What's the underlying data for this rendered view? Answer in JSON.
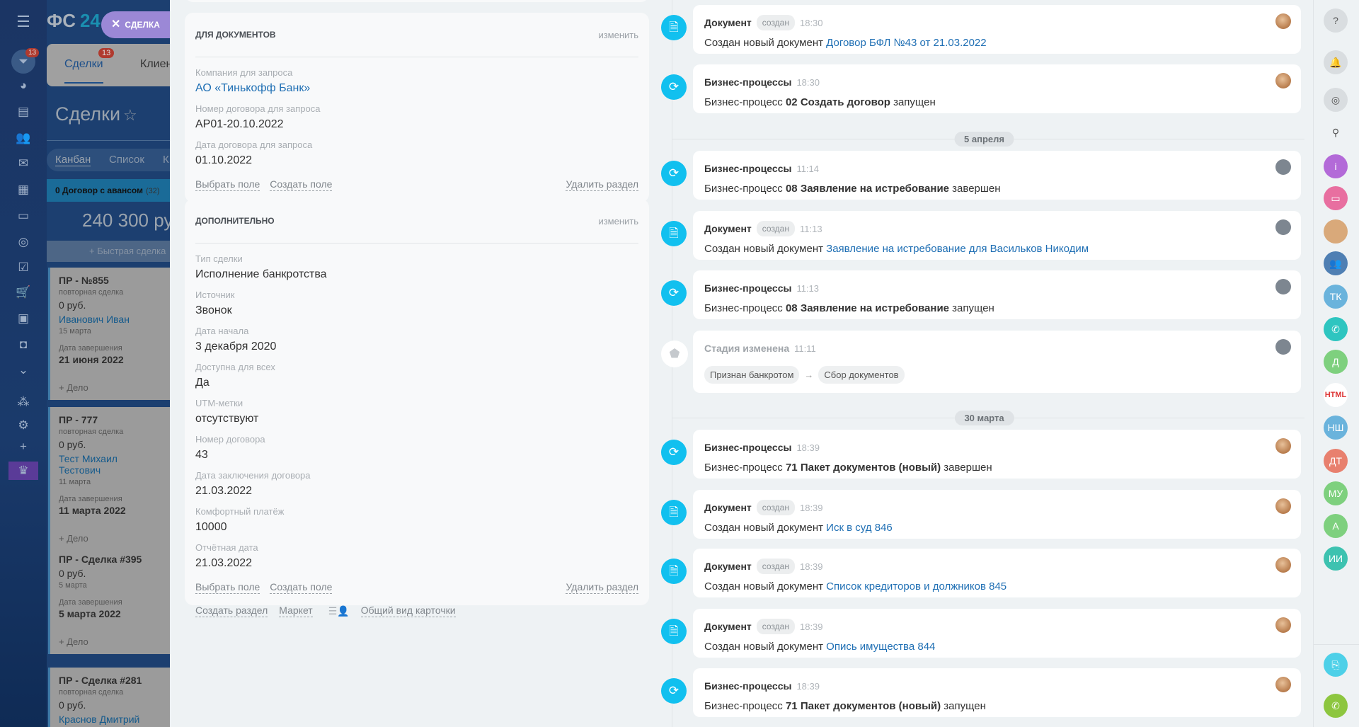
{
  "leftnav": {
    "menu_icon": "hamburger-icon",
    "logo_text": "ФС",
    "logo_num": "24",
    "filter_badge": "13",
    "icons": [
      "funnel-icon",
      "chart-icon",
      "calendar-icon",
      "users-icon",
      "mail-icon",
      "document-icon",
      "contact-card-icon",
      "target-icon",
      "task-icon",
      "cart-icon",
      "box-icon",
      "robot-icon",
      "chevron-down-icon",
      "sitemap-icon",
      "gear-icon",
      "plus-icon",
      "crown-icon"
    ]
  },
  "close_tab": {
    "label": "СДЕЛКА"
  },
  "crm": {
    "tabs": [
      {
        "label": "Сделки",
        "badge": "13"
      },
      {
        "label": "Клиен"
      }
    ],
    "title": "Сделки",
    "views": [
      "Канбан",
      "Список",
      "К"
    ],
    "column": {
      "name": "0 Договор с авансом",
      "count": "(32)",
      "sum": "240 300 ру",
      "quick_add": "Быстрая сделка"
    },
    "cards": [
      {
        "title": "ПР - №855",
        "sub": "повторная сделка",
        "price": "0 руб.",
        "name": "Иванович Иван",
        "date": "15 марта",
        "end_label": "Дата завершения",
        "end": "21 июня 2022",
        "add": "+ Дело"
      },
      {
        "title": "ПР - 777",
        "sub": "повторная сделка",
        "price": "0 руб.",
        "name": "Тест Михаил Тестович",
        "date": "11 марта",
        "end_label": "Дата завершения",
        "end": "11 марта 2022",
        "add": "+ Дело"
      },
      {
        "title": "ПР - Сделка #395",
        "price": "0 руб.",
        "date": "5 марта",
        "end_label": "Дата завершения",
        "end": "5 марта 2022",
        "add": "+ Дело"
      },
      {
        "title": "ПР - Сделка #281",
        "sub": "повторная сделка",
        "price": "0 руб.",
        "name": "Краснов Дмитрий"
      }
    ]
  },
  "sections": [
    {
      "title": "для документов",
      "edit": "изменить",
      "fields": [
        {
          "label": "Компания для запроса",
          "value": "АО «Тинькофф Банк»",
          "link": true
        },
        {
          "label": "Номер договора для запроса",
          "value": "АР01-20.10.2022"
        },
        {
          "label": "Дата договора для запроса",
          "value": "01.10.2022"
        }
      ],
      "select_field": "Выбрать поле",
      "create_field": "Создать поле",
      "delete": "Удалить раздел"
    },
    {
      "title": "дополнительно",
      "edit": "изменить",
      "fields": [
        {
          "label": "Тип сделки",
          "value": "Исполнение банкротства"
        },
        {
          "label": "Источник",
          "value": "Звонок"
        },
        {
          "label": "Дата начала",
          "value": "3 декабря 2020"
        },
        {
          "label": "Доступна для всех",
          "value": "Да"
        },
        {
          "label": "UTM-метки",
          "value": "отсутствуют"
        },
        {
          "label": "Номер договора",
          "value": "43"
        },
        {
          "label": "Дата заключения договора",
          "value": "21.03.2022"
        },
        {
          "label": "Комфортный платёж",
          "value": "10000"
        },
        {
          "label": "Отчётная дата",
          "value": "21.03.2022"
        }
      ],
      "select_field": "Выбрать поле",
      "create_field": "Создать поле",
      "delete": "Удалить раздел"
    }
  ],
  "bottom_links": {
    "create_section": "Создать раздел",
    "market": "Маркет",
    "common_view": "Общий вид карточки"
  },
  "timeline": [
    {
      "kind": "doc",
      "type": "Документ",
      "badge": "создан",
      "time": "18:30",
      "prefix": "Создан новый документ ",
      "link": "Договор БФЛ №43 от 21.03.2022",
      "avatar": "photo"
    },
    {
      "kind": "bp",
      "type": "Бизнес-процессы",
      "time": "18:30",
      "prefix": "Бизнес-процесс ",
      "bold": "02 Создать договор",
      "suffix": " запущен",
      "avatar": "photo"
    },
    {
      "kind": "date",
      "label": "5 апреля"
    },
    {
      "kind": "bp",
      "type": "Бизнес-процессы",
      "time": "11:14",
      "prefix": "Бизнес-процесс ",
      "bold": "08 Заявление на истребование",
      "suffix": " завершен",
      "avatar": "default"
    },
    {
      "kind": "doc",
      "type": "Документ",
      "badge": "создан",
      "time": "11:13",
      "prefix": "Создан новый документ ",
      "link": "Заявление на истребование для Васильков Никодим",
      "avatar": "default"
    },
    {
      "kind": "bp",
      "type": "Бизнес-процессы",
      "time": "11:13",
      "prefix": "Бизнес-процесс ",
      "bold": "08 Заявление на истребование",
      "suffix": " запущен",
      "avatar": "default"
    },
    {
      "kind": "stage",
      "type": "Стадия изменена",
      "time": "11:11",
      "from": "Признан банкротом",
      "arrow": "→",
      "to": "Сбор документов",
      "avatar": "default"
    },
    {
      "kind": "date",
      "label": "30 марта"
    },
    {
      "kind": "bp",
      "type": "Бизнес-процессы",
      "time": "18:39",
      "prefix": "Бизнес-процесс ",
      "bold": "71 Пакет документов (новый)",
      "suffix": " завершен",
      "avatar": "photo"
    },
    {
      "kind": "doc",
      "type": "Документ",
      "badge": "создан",
      "time": "18:39",
      "prefix": "Создан новый документ ",
      "link": "Иск в суд 846",
      "avatar": "photo"
    },
    {
      "kind": "doc",
      "type": "Документ",
      "badge": "создан",
      "time": "18:39",
      "prefix": "Создан новый документ ",
      "link": "Список кредиторов и должников 845",
      "avatar": "photo"
    },
    {
      "kind": "doc",
      "type": "Документ",
      "badge": "создан",
      "time": "18:39",
      "prefix": "Создан новый документ ",
      "link": "Опись имущества 844",
      "avatar": "photo"
    },
    {
      "kind": "bp",
      "type": "Бизнес-процессы",
      "time": "18:39",
      "prefix": "Бизнес-процесс ",
      "bold": "71 Пакет документов (новый)",
      "suffix": " запущен",
      "avatar": "photo"
    }
  ],
  "rightbar": [
    {
      "icon": "help-icon",
      "text": "?",
      "color": "#d9dde0"
    },
    {
      "icon": "bell-icon",
      "text": "🔔",
      "color": "#d9dde0"
    },
    {
      "icon": "chat-icon",
      "text": "◎",
      "color": "#d9dde0"
    },
    {
      "icon": "search-icon",
      "text": "⚲",
      "color": "transparent"
    },
    {
      "icon": "info-icon",
      "text": "i",
      "color": "#b36ad8"
    },
    {
      "icon": "message-icon",
      "text": "▭",
      "color": "#e86fa0"
    },
    {
      "icon": "group-photo-icon",
      "text": "",
      "color": "#d9a97a"
    },
    {
      "icon": "team-chat-icon",
      "text": "👥",
      "color": "#4f7fb3"
    },
    {
      "icon": "avatar",
      "text": "ТК",
      "color": "#6ab3dc"
    },
    {
      "icon": "phone-icon",
      "text": "✆",
      "color": "#2ec5c0"
    },
    {
      "icon": "avatar",
      "text": "Д",
      "color": "#7ed07e"
    },
    {
      "icon": "html-studio-icon",
      "text": "HTML",
      "color": "#ffffff"
    },
    {
      "icon": "avatar",
      "text": "НШ",
      "color": "#6ab3dc"
    },
    {
      "icon": "avatar",
      "text": "ДТ",
      "color": "#e8806e"
    },
    {
      "icon": "avatar",
      "text": "МУ",
      "color": "#7ed07e"
    },
    {
      "icon": "avatar",
      "text": "А",
      "color": "#7ed07e"
    },
    {
      "icon": "avatar",
      "text": "ИИ",
      "color": "#3dc2b0"
    },
    {
      "icon": "screen-share-icon",
      "text": "⎘",
      "color": "#4dd0e8"
    },
    {
      "icon": "call-icon",
      "text": "✆",
      "color": "#8dc63f"
    }
  ]
}
